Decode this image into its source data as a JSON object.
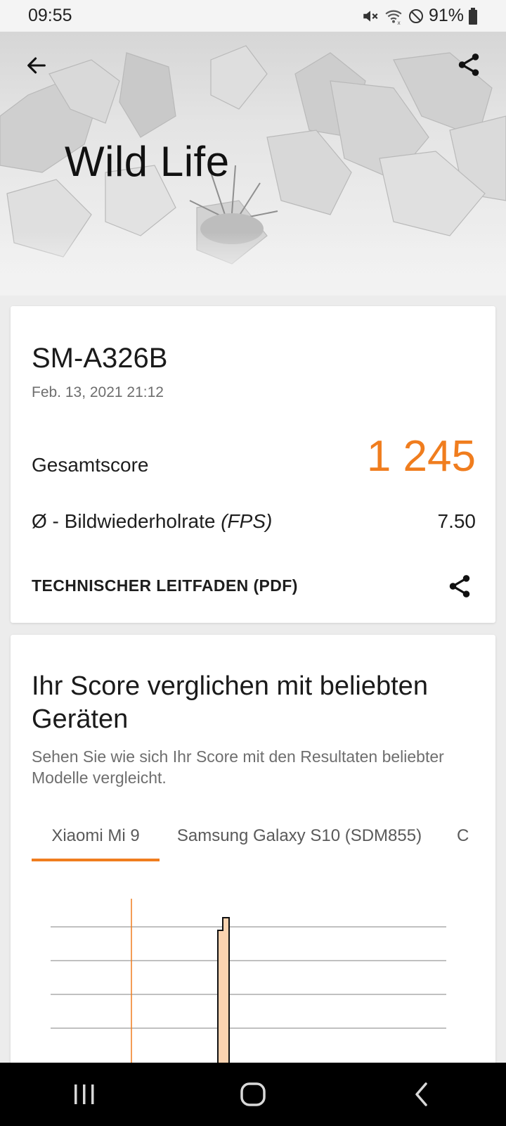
{
  "status_bar": {
    "time": "09:55",
    "battery_percent": "91%",
    "icons": [
      "mute-icon",
      "wifi-icon",
      "do-not-disturb-icon",
      "battery-icon"
    ]
  },
  "hero": {
    "title": "Wild Life",
    "back_icon": "arrow-left-icon",
    "share_icon": "share-icon"
  },
  "result": {
    "device": "SM-A326B",
    "date": "Feb. 13, 2021 21:12",
    "score_label": "Gesamtscore",
    "score_value": "1 245",
    "fps_label_prefix": "Ø - Bildwiederholrate ",
    "fps_label_unit": "(FPS)",
    "fps_value": "7.50",
    "guide_label": "TECHNISCHER LEITFADEN (PDF)",
    "guide_icon": "share-icon"
  },
  "compare": {
    "title": "Ihr Score verglichen mit beliebten Geräten",
    "subtitle": "Sehen Sie wie sich Ihr Score mit den Resultaten beliebter Modelle vergleicht.",
    "tabs": [
      {
        "label": "Xiaomi Mi 9",
        "active": true
      },
      {
        "label": "Samsung Galaxy S10 (SDM855)",
        "active": false
      },
      {
        "label": "C",
        "active": false
      }
    ]
  },
  "nav_bar": {
    "icons": [
      "recents-icon",
      "home-icon",
      "back-icon"
    ]
  },
  "colors": {
    "accent": "#f07d1e",
    "bar_fill": "#fbd3b0"
  }
}
